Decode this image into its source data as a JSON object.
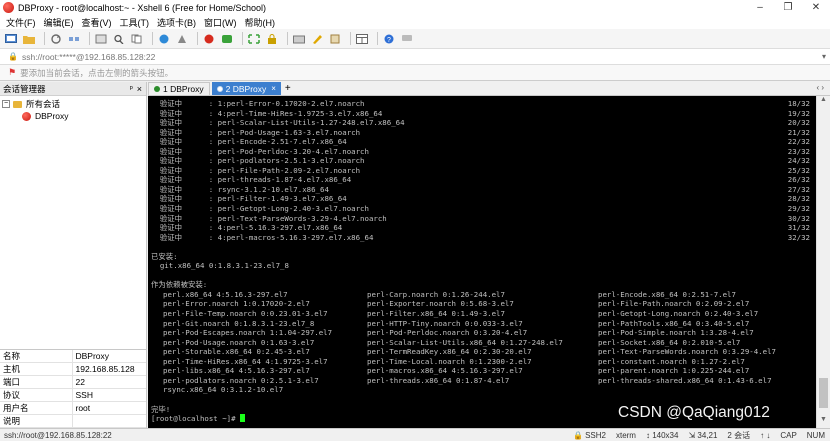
{
  "window": {
    "title": "DBProxy - root@localhost:~ - Xshell 6 (Free for Home/School)"
  },
  "menu": [
    "文件(F)",
    "编辑(E)",
    "查看(V)",
    "工具(T)",
    "选项卡(B)",
    "窗口(W)",
    "帮助(H)"
  ],
  "address": {
    "text": "ssh://root:*****@192.168.85.128:22"
  },
  "hint": {
    "text": "要添加当前会话，点击左侧的箭头按钮。"
  },
  "session_panel": {
    "title": "会话管理器",
    "pin": "ᵖ",
    "close": "×",
    "tree": {
      "root": "所有会话",
      "root_toggle": "−",
      "child": "DBProxy"
    },
    "properties": [
      {
        "k": "名称",
        "v": "DBProxy"
      },
      {
        "k": "主机",
        "v": "192.168.85.128"
      },
      {
        "k": "端口",
        "v": "22"
      },
      {
        "k": "协议",
        "v": "SSH"
      },
      {
        "k": "用户名",
        "v": "root"
      },
      {
        "k": "说明",
        "v": ""
      }
    ]
  },
  "tabs": [
    {
      "label": "1 DBProxy",
      "active": false,
      "close": ""
    },
    {
      "label": "2 DBProxy",
      "active": true,
      "close": "×"
    }
  ],
  "tab_add": "+",
  "tab_nav": "‹ ›",
  "terminal": {
    "verify_lines": [
      {
        "text": "  验证中      : 1:perl-Error-0.17020-2.el7.noarch",
        "num": "18/32"
      },
      {
        "text": "  验证中      : 4:perl-Time-HiRes-1.9725-3.el7.x86_64",
        "num": "19/32"
      },
      {
        "text": "  验证中      : perl-Scalar-List-Utils-1.27-248.el7.x86_64",
        "num": "20/32"
      },
      {
        "text": "  验证中      : perl-Pod-Usage-1.63-3.el7.noarch",
        "num": "21/32"
      },
      {
        "text": "  验证中      : perl-Encode-2.51-7.el7.x86_64",
        "num": "22/32"
      },
      {
        "text": "  验证中      : perl-Pod-Perldoc-3.20-4.el7.noarch",
        "num": "23/32"
      },
      {
        "text": "  验证中      : perl-podlators-2.5.1-3.el7.noarch",
        "num": "24/32"
      },
      {
        "text": "  验证中      : perl-File-Path-2.09-2.el7.noarch",
        "num": "25/32"
      },
      {
        "text": "  验证中      : perl-threads-1.87-4.el7.x86_64",
        "num": "26/32"
      },
      {
        "text": "  验证中      : rsync-3.1.2-10.el7.x86_64",
        "num": "27/32"
      },
      {
        "text": "  验证中      : perl-Filter-1.49-3.el7.x86_64",
        "num": "28/32"
      },
      {
        "text": "  验证中      : perl-Getopt-Long-2.40-3.el7.noarch",
        "num": "29/32"
      },
      {
        "text": "  验证中      : perl-Text-ParseWords-3.29-4.el7.noarch",
        "num": "30/32"
      },
      {
        "text": "  验证中      : 4:perl-5.16.3-297.el7.x86_64",
        "num": "31/32"
      },
      {
        "text": "  验证中      : 4:perl-macros-5.16.3-297.el7.x86_64",
        "num": "32/32"
      }
    ],
    "installed_header": "已安装:",
    "installed_item": "  git.x86_64 0:1.8.3.1-23.el7_8",
    "deps_header": "作为依赖被安装:",
    "deps": [
      [
        "perl.x86_64 4:5.16.3-297.el7",
        "perl-Carp.noarch 0:1.26-244.el7",
        "perl-Encode.x86_64 0:2.51-7.el7"
      ],
      [
        "perl-Error.noarch 1:0.17020-2.el7",
        "perl-Exporter.noarch 0:5.68-3.el7",
        "perl-File-Path.noarch 0:2.09-2.el7"
      ],
      [
        "perl-File-Temp.noarch 0:0.23.01-3.el7",
        "perl-Filter.x86_64 0:1.49-3.el7",
        "perl-Getopt-Long.noarch 0:2.40-3.el7"
      ],
      [
        "perl-Git.noarch 0:1.8.3.1-23.el7_8",
        "perl-HTTP-Tiny.noarch 0:0.033-3.el7",
        "perl-PathTools.x86_64 0:3.40-5.el7"
      ],
      [
        "perl-Pod-Escapes.noarch 1:1.04-297.el7",
        "perl-Pod-Perldoc.noarch 0:3.20-4.el7",
        "perl-Pod-Simple.noarch 1:3.28-4.el7"
      ],
      [
        "perl-Pod-Usage.noarch 0:1.63-3.el7",
        "perl-Scalar-List-Utils.x86_64 0:1.27-248.el7",
        "perl-Socket.x86_64 0:2.010-5.el7"
      ],
      [
        "perl-Storable.x86_64 0:2.45-3.el7",
        "perl-TermReadKey.x86_64 0:2.30-20.el7",
        "perl-Text-ParseWords.noarch 0:3.29-4.el7"
      ],
      [
        "perl-Time-HiRes.x86_64 4:1.9725-3.el7",
        "perl-Time-Local.noarch 0:1.2300-2.el7",
        "perl-constant.noarch 0:1.27-2.el7"
      ],
      [
        "perl-libs.x86_64 4:5.16.3-297.el7",
        "perl-macros.x86_64 4:5.16.3-297.el7",
        "perl-parent.noarch 1:0.225-244.el7"
      ],
      [
        "perl-podlators.noarch 0:2.5.1-3.el7",
        "perl-threads.x86_64 0:1.87-4.el7",
        "perl-threads-shared.x86_64 0:1.43-6.el7"
      ],
      [
        "rsync.x86_64 0:3.1.2-10.el7",
        "",
        ""
      ]
    ],
    "done": "完毕!",
    "prompt": "[root@localhost ~]# "
  },
  "watermark": "CSDN @QaQiang012",
  "status": {
    "left": "ssh://root@192.168.85.128:22",
    "protocol": "SSH2",
    "terminal_type": "xterm",
    "size": "140x34",
    "size_icon": "↕",
    "cursor_pos": "34,21",
    "pos_icon": "⇲",
    "sessions": "2 会话",
    "caps": "CAP",
    "num": "NUM",
    "arrows": "↑ ↓"
  }
}
